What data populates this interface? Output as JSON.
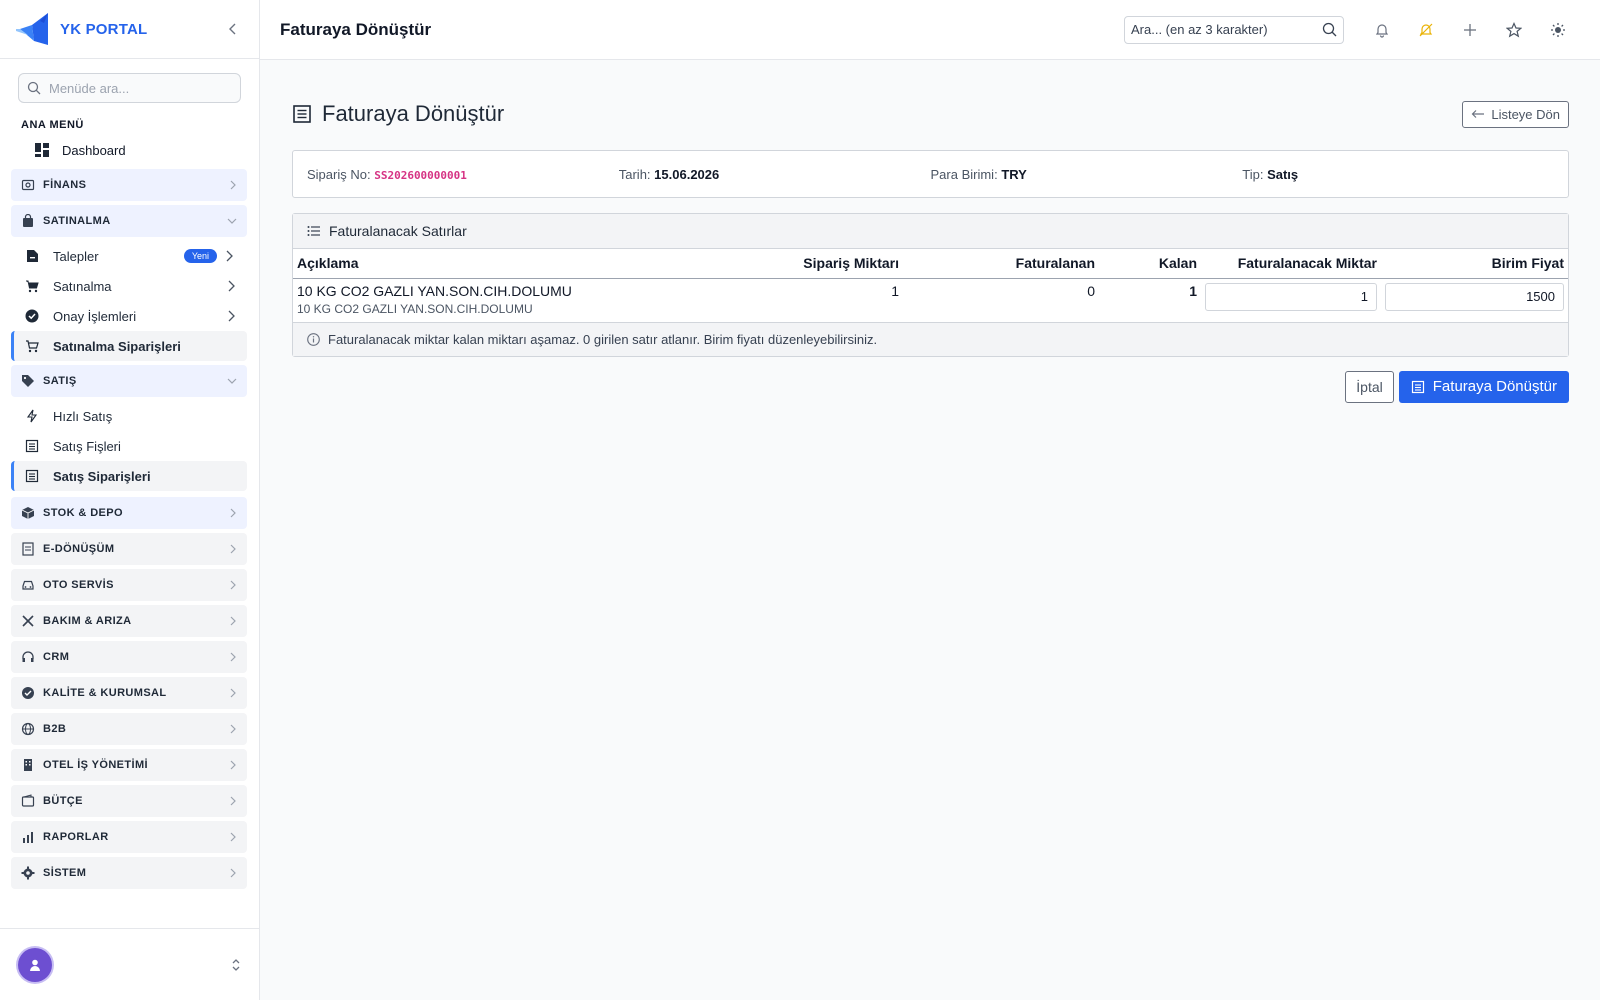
{
  "brand": {
    "name": "YK PORTAL"
  },
  "sidebar": {
    "search_placeholder": "Menüde ara...",
    "section_label": "ANA MENÜ",
    "dashboard": "Dashboard",
    "groups": {
      "finans": "FİNANS",
      "satinalma": "SATINALMA",
      "satis": "SATIŞ",
      "stok": "STOK & DEPO",
      "edonusum": "E-DÖNÜŞÜM",
      "oto": "OTO SERVİS",
      "bakim": "BAKIM & ARIZA",
      "crm": "CRM",
      "kalite": "KALİTE & KURUMSAL",
      "b2b": "B2B",
      "otel": "OTEL İŞ YÖNETİMİ",
      "butce": "BÜTÇE",
      "raporlar": "RAPORLAR",
      "sistem": "SİSTEM"
    },
    "satinalma_items": {
      "talepler": "Talepler",
      "talepler_badge": "Yeni",
      "satinalma": "Satınalma",
      "onay": "Onay İşlemleri",
      "siparisler": "Satınalma Siparişleri"
    },
    "satis_items": {
      "hizli": "Hızlı Satış",
      "fisler": "Satış Fişleri",
      "siparisler": "Satış Siparişleri"
    }
  },
  "topbar": {
    "title": "Faturaya Dönüştür",
    "search_placeholder": "Ara... (en az 3 karakter)"
  },
  "page": {
    "title": "Faturaya Dönüştür",
    "back_label": "Listeye Dön",
    "info": {
      "order_no_label": "Sipariş No:",
      "order_no": "SS202600000001",
      "date_label": "Tarih:",
      "date": "15.06.2026",
      "currency_label": "Para Birimi:",
      "currency": "TRY",
      "type_label": "Tip:",
      "type": "Satış"
    },
    "lines_title": "Faturalanacak Satırlar",
    "columns": {
      "desc": "Açıklama",
      "ordered": "Sipariş Miktarı",
      "invoiced": "Faturalanan",
      "remaining": "Kalan",
      "to_invoice": "Faturalanacak Miktar",
      "unit_price": "Birim Fiyat"
    },
    "rows": [
      {
        "desc": "10 KG CO2 GAZLI YAN.SON.CIH.DOLUMU",
        "desc_sub": "10 KG CO2 GAZLI YAN.SON.CIH.DOLUMU",
        "ordered": "1",
        "invoiced": "0",
        "remaining": "1",
        "to_invoice": "1",
        "unit_price": "1500"
      }
    ],
    "note": "Faturalanacak miktar kalan miktarı aşamaz. 0 girilen satır atlanır. Birim fiyatı düzenleyebilirsiniz.",
    "cancel_label": "İptal",
    "submit_label": "Faturaya Dönüştür"
  },
  "colors": {
    "primary": "#2563eb",
    "order_no": "#d63384",
    "group_bg": "#eef2ff",
    "avatar": "#6d4fd1"
  }
}
